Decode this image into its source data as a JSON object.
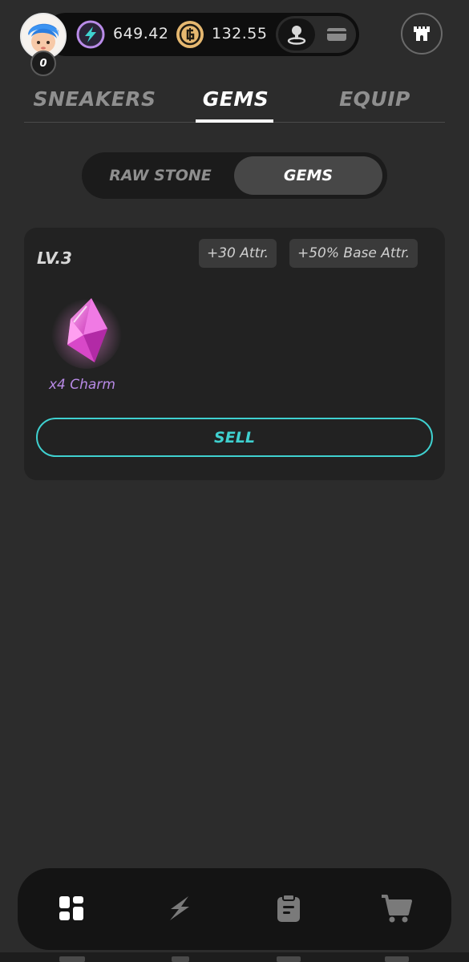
{
  "header": {
    "level_badge": "0",
    "energy": "649.42",
    "gmt": "132.55",
    "icons": {
      "energy": "energy-bolt-icon",
      "gmt": "gmt-coin-icon",
      "mode_move": "location-pin-icon",
      "mode_wallet": "wallet-card-icon",
      "realm": "castle-icon"
    }
  },
  "tabs": [
    {
      "label": "SNEAKERS",
      "active": false
    },
    {
      "label": "GEMS",
      "active": true
    },
    {
      "label": "EQUIP",
      "active": false
    }
  ],
  "segment": [
    {
      "label": "RAW STONE",
      "active": false
    },
    {
      "label": "GEMS",
      "active": true
    }
  ],
  "gem_card": {
    "level": "LV.3",
    "attrs": [
      "+30 Attr.",
      "+50% Base Attr."
    ],
    "gem_label": "x4 Charm",
    "gem_type": "Charm",
    "gem_color": "#e060d8",
    "sell_label": "SELL"
  },
  "bottom_nav": [
    {
      "icon": "dashboard-icon",
      "active": true
    },
    {
      "icon": "lightning-icon",
      "active": false
    },
    {
      "icon": "clipboard-icon",
      "active": false
    },
    {
      "icon": "cart-icon",
      "active": false
    }
  ],
  "colors": {
    "background": "#2c2c2c",
    "card": "#222222",
    "accent": "#3fd1d0",
    "gem_text": "#b88ae6"
  }
}
